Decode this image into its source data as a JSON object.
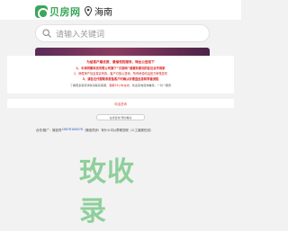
{
  "header": {
    "logo_text": "贝房网",
    "city": "海南"
  },
  "search": {
    "placeholder": "请输入关键词"
  },
  "notice": {
    "title": "为给客户最优质、最愉悦的服务，特此公告如下",
    "line1": "1、中津同聚科技有限公司旗下“贝房网”诚邀有意向的各位合作商家",
    "line2": "2、房屋房产信息真实有效，客户可放心咨询，所有房源均由官方审核发布",
    "line3": "3、请各位代理联系报备客户时确认好楼盘信息和带看流程",
    "line4_prefix": "了解更多房源详情请联系客服，",
    "line4_highlight": "客服24小时在线",
    "line4_suffix": "，欢迎来电咨询看房，一对一服务"
  },
  "section": {
    "heading": "电话咨询"
  },
  "pill": {
    "label": "在线咨询·预约看房"
  },
  "contact": {
    "prefix": "合作/推广：微信同",
    "phone": "18876164876",
    "suffix": "（微信同步）有什么可以帮助您呢（人工客服在线）"
  },
  "watermark": {
    "text": "玫收录"
  },
  "colors": {
    "brand_green": "#3aa65a",
    "alert_red": "#e02020",
    "banner_purple": "#6b2f5c"
  }
}
